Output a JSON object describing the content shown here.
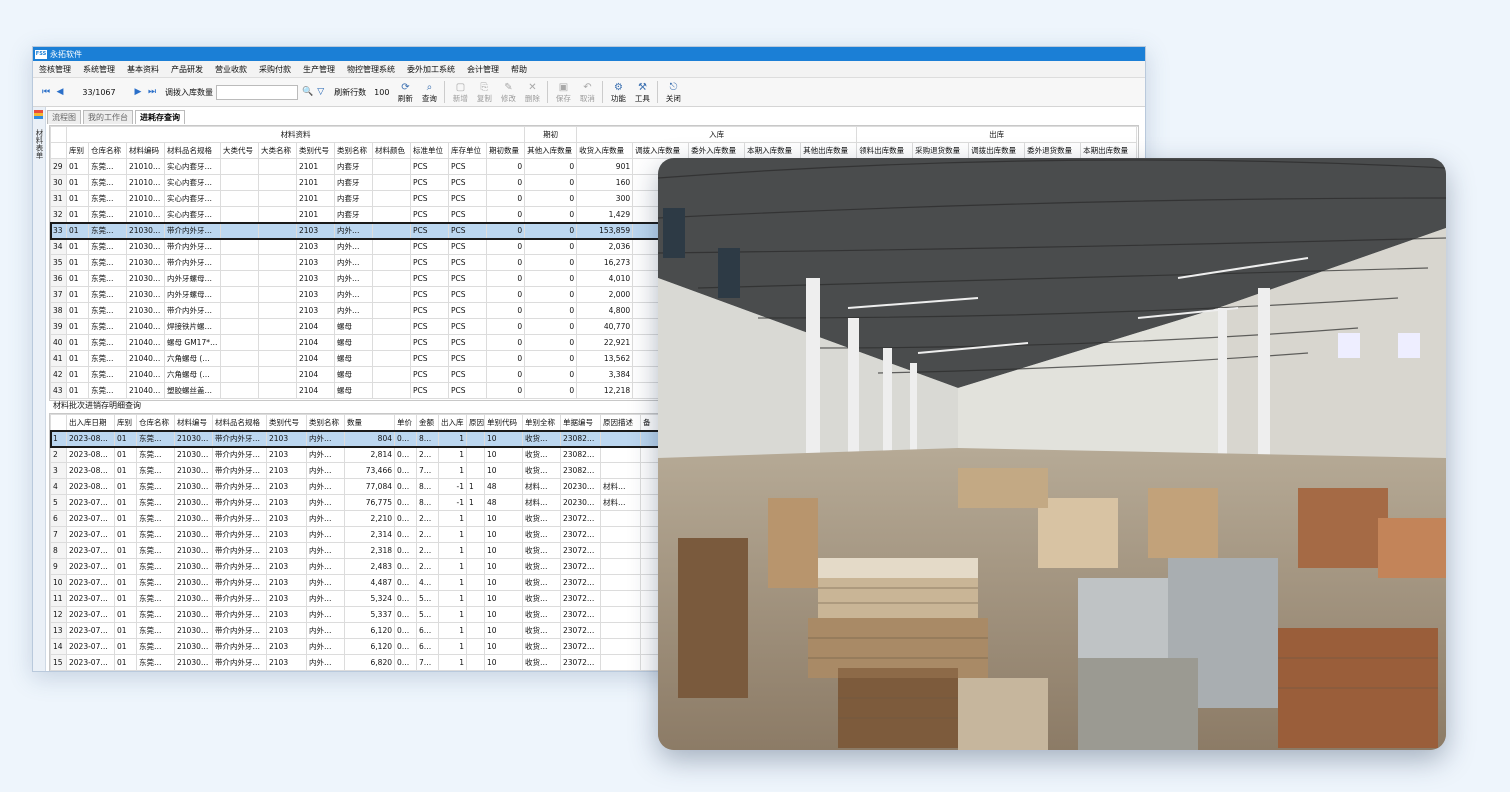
{
  "window": {
    "title": "永拓软件",
    "logo": "FSS"
  },
  "menu": [
    "签核管理",
    "系统管理",
    "基本资料",
    "产品研发",
    "营业收款",
    "采购付款",
    "生产管理",
    "物控管理系统",
    "委外加工系统",
    "会计管理",
    "帮助"
  ],
  "toolbar": {
    "record_pos": "33/1067",
    "query_label": "调拨入库数量",
    "refresh_rows_label": "刷新行数",
    "refresh_rows_value": "100",
    "buttons": [
      {
        "label": "刷新",
        "icon": "refresh-icon",
        "enabled": true
      },
      {
        "label": "查询",
        "icon": "query-icon",
        "enabled": true
      },
      {
        "label": "新增",
        "icon": "new-icon",
        "enabled": false
      },
      {
        "label": "复制",
        "icon": "copy-icon",
        "enabled": false
      },
      {
        "label": "修改",
        "icon": "edit-icon",
        "enabled": false
      },
      {
        "label": "删除",
        "icon": "delete-icon",
        "enabled": false
      },
      {
        "label": "保存",
        "icon": "save-icon",
        "enabled": false
      },
      {
        "label": "取消",
        "icon": "cancel-icon",
        "enabled": false
      },
      {
        "label": "功能",
        "icon": "function-icon",
        "enabled": true
      },
      {
        "label": "工具",
        "icon": "tools-icon",
        "enabled": true
      },
      {
        "label": "关闭",
        "icon": "close-icon",
        "enabled": true
      }
    ]
  },
  "side_panel": {
    "label": "材料表单"
  },
  "tabs": [
    "流程图",
    "我的工作台",
    "进耗存查询"
  ],
  "grid1": {
    "groups": [
      {
        "label": "材料资料",
        "span": 12
      },
      {
        "label": "期初",
        "span": 1
      },
      {
        "label": "入库",
        "span": 5
      },
      {
        "label": "出库",
        "span": 6
      }
    ],
    "headers": [
      "库别",
      "仓库名称",
      "材料编码",
      "材料品名规格",
      "大类代号",
      "大类名称",
      "类别代号",
      "类别名称",
      "材料颜色",
      "标准单位",
      "库存单位",
      "期初数量",
      "其他入库数量",
      "收货入库数量",
      "调拨入库数量",
      "委外入库数量",
      "本期入库数量",
      "其他出库数量",
      "领料出库数量",
      "采购退货数量",
      "调拨出库数量",
      "委外退货数量",
      "本期出库数量"
    ],
    "rows": [
      {
        "no": "29",
        "cells": [
          "01",
          "东莞…",
          "21010…",
          "实心内套牙…",
          "",
          "",
          "2101",
          "内套牙",
          "",
          "PCS",
          "PCS",
          "0",
          "0",
          "901"
        ]
      },
      {
        "no": "30",
        "cells": [
          "01",
          "东莞…",
          "21010…",
          "实心内套牙…",
          "",
          "",
          "2101",
          "内套牙",
          "",
          "PCS",
          "PCS",
          "0",
          "0",
          "160"
        ]
      },
      {
        "no": "31",
        "cells": [
          "01",
          "东莞…",
          "21010…",
          "实心内套牙…",
          "",
          "",
          "2101",
          "内套牙",
          "",
          "PCS",
          "PCS",
          "0",
          "0",
          "300"
        ]
      },
      {
        "no": "32",
        "cells": [
          "01",
          "东莞…",
          "21010…",
          "实心内套牙…",
          "",
          "",
          "2101",
          "内套牙",
          "",
          "PCS",
          "PCS",
          "0",
          "0",
          "1,429"
        ]
      },
      {
        "no": "33",
        "cells": [
          "01",
          "东莞…",
          "21030…",
          "带介内外牙…",
          "",
          "",
          "2103",
          "内外…",
          "",
          "PCS",
          "PCS",
          "0",
          "0",
          "153,859"
        ],
        "selected": true
      },
      {
        "no": "34",
        "cells": [
          "01",
          "东莞…",
          "21030…",
          "带介内外牙…",
          "",
          "",
          "2103",
          "内外…",
          "",
          "PCS",
          "PCS",
          "0",
          "0",
          "2,036"
        ]
      },
      {
        "no": "35",
        "cells": [
          "01",
          "东莞…",
          "21030…",
          "带介内外牙…",
          "",
          "",
          "2103",
          "内外…",
          "",
          "PCS",
          "PCS",
          "0",
          "0",
          "16,273"
        ]
      },
      {
        "no": "36",
        "cells": [
          "01",
          "东莞…",
          "21030…",
          "内外牙螺母…",
          "",
          "",
          "2103",
          "内外…",
          "",
          "PCS",
          "PCS",
          "0",
          "0",
          "4,010"
        ]
      },
      {
        "no": "37",
        "cells": [
          "01",
          "东莞…",
          "21030…",
          "内外牙螺母…",
          "",
          "",
          "2103",
          "内外…",
          "",
          "PCS",
          "PCS",
          "0",
          "0",
          "2,000"
        ]
      },
      {
        "no": "38",
        "cells": [
          "01",
          "东莞…",
          "21030…",
          "带介内外牙…",
          "",
          "",
          "2103",
          "内外…",
          "",
          "PCS",
          "PCS",
          "0",
          "0",
          "4,800"
        ]
      },
      {
        "no": "39",
        "cells": [
          "01",
          "东莞…",
          "21040…",
          "焊接铁片螺…",
          "",
          "",
          "2104",
          "螺母",
          "",
          "PCS",
          "PCS",
          "0",
          "0",
          "40,770"
        ]
      },
      {
        "no": "40",
        "cells": [
          "01",
          "东莞…",
          "21040…",
          "螺母 GM17*…",
          "",
          "",
          "2104",
          "螺母",
          "",
          "PCS",
          "PCS",
          "0",
          "0",
          "22,921"
        ]
      },
      {
        "no": "41",
        "cells": [
          "01",
          "东莞…",
          "21040…",
          "六角螺母 (…",
          "",
          "",
          "2104",
          "螺母",
          "",
          "PCS",
          "PCS",
          "0",
          "0",
          "13,562"
        ]
      },
      {
        "no": "42",
        "cells": [
          "01",
          "东莞…",
          "21040…",
          "六角螺母 (…",
          "",
          "",
          "2104",
          "螺母",
          "",
          "PCS",
          "PCS",
          "0",
          "0",
          "3,384"
        ]
      },
      {
        "no": "43",
        "cells": [
          "01",
          "东莞…",
          "21040…",
          "塑胶螺丝盖…",
          "",
          "",
          "2104",
          "螺母",
          "",
          "PCS",
          "PCS",
          "0",
          "0",
          "12,218"
        ]
      }
    ]
  },
  "section2_title": "材料批次进销存明细查询",
  "grid2": {
    "headers": [
      "出入库日期",
      "库别",
      "仓库名称",
      "材料编号",
      "材料品名规格",
      "类别代号",
      "类别名称",
      "数量",
      "单价",
      "金额",
      "出入库",
      "原因",
      "单别代码",
      "单别全称",
      "单据编号",
      "原因描述",
      "备"
    ],
    "rows": [
      {
        "no": "1",
        "cells": [
          "2023-08…",
          "01",
          "东莞…",
          "21030…",
          "带介内外牙…",
          "2103",
          "内外…",
          "804",
          "0…",
          "8…",
          "1",
          "",
          "10",
          "收货…",
          "23082…",
          "",
          ""
        ],
        "selected": true
      },
      {
        "no": "2",
        "cells": [
          "2023-08…",
          "01",
          "东莞…",
          "21030…",
          "带介内外牙…",
          "2103",
          "内外…",
          "2,814",
          "0…",
          "2…",
          "1",
          "",
          "10",
          "收货…",
          "23082…",
          "",
          ""
        ]
      },
      {
        "no": "3",
        "cells": [
          "2023-08…",
          "01",
          "东莞…",
          "21030…",
          "带介内外牙…",
          "2103",
          "内外…",
          "73,466",
          "0…",
          "7…",
          "1",
          "",
          "10",
          "收货…",
          "23082…",
          "",
          ""
        ]
      },
      {
        "no": "4",
        "cells": [
          "2023-08…",
          "01",
          "东莞…",
          "21030…",
          "带介内外牙…",
          "2103",
          "内外…",
          "77,084",
          "0…",
          "8…",
          "-1",
          "1",
          "48",
          "材料…",
          "20230…",
          "材料…",
          ""
        ]
      },
      {
        "no": "5",
        "cells": [
          "2023-07…",
          "01",
          "东莞…",
          "21030…",
          "带介内外牙…",
          "2103",
          "内外…",
          "76,775",
          "0…",
          "8…",
          "-1",
          "1",
          "48",
          "材料…",
          "20230…",
          "材料…",
          ""
        ]
      },
      {
        "no": "6",
        "cells": [
          "2023-07…",
          "01",
          "东莞…",
          "21030…",
          "带介内外牙…",
          "2103",
          "内外…",
          "2,210",
          "0…",
          "2…",
          "1",
          "",
          "10",
          "收货…",
          "23072…",
          "",
          ""
        ]
      },
      {
        "no": "7",
        "cells": [
          "2023-07…",
          "01",
          "东莞…",
          "21030…",
          "带介内外牙…",
          "2103",
          "内外…",
          "2,314",
          "0…",
          "2…",
          "1",
          "",
          "10",
          "收货…",
          "23072…",
          "",
          ""
        ]
      },
      {
        "no": "8",
        "cells": [
          "2023-07…",
          "01",
          "东莞…",
          "21030…",
          "带介内外牙…",
          "2103",
          "内外…",
          "2,318",
          "0…",
          "2…",
          "1",
          "",
          "10",
          "收货…",
          "23072…",
          "",
          ""
        ]
      },
      {
        "no": "9",
        "cells": [
          "2023-07…",
          "01",
          "东莞…",
          "21030…",
          "带介内外牙…",
          "2103",
          "内外…",
          "2,483",
          "0…",
          "2…",
          "1",
          "",
          "10",
          "收货…",
          "23072…",
          "",
          ""
        ]
      },
      {
        "no": "10",
        "cells": [
          "2023-07…",
          "01",
          "东莞…",
          "21030…",
          "带介内外牙…",
          "2103",
          "内外…",
          "4,487",
          "0…",
          "4…",
          "1",
          "",
          "10",
          "收货…",
          "23072…",
          "",
          ""
        ]
      },
      {
        "no": "11",
        "cells": [
          "2023-07…",
          "01",
          "东莞…",
          "21030…",
          "带介内外牙…",
          "2103",
          "内外…",
          "5,324",
          "0…",
          "5…",
          "1",
          "",
          "10",
          "收货…",
          "23072…",
          "",
          ""
        ]
      },
      {
        "no": "12",
        "cells": [
          "2023-07…",
          "01",
          "东莞…",
          "21030…",
          "带介内外牙…",
          "2103",
          "内外…",
          "5,337",
          "0…",
          "5…",
          "1",
          "",
          "10",
          "收货…",
          "23072…",
          "",
          ""
        ]
      },
      {
        "no": "13",
        "cells": [
          "2023-07…",
          "01",
          "东莞…",
          "21030…",
          "带介内外牙…",
          "2103",
          "内外…",
          "6,120",
          "0…",
          "6…",
          "1",
          "",
          "10",
          "收货…",
          "23072…",
          "",
          ""
        ]
      },
      {
        "no": "14",
        "cells": [
          "2023-07…",
          "01",
          "东莞…",
          "21030…",
          "带介内外牙…",
          "2103",
          "内外…",
          "6,120",
          "0…",
          "6…",
          "1",
          "",
          "10",
          "收货…",
          "23072…",
          "",
          ""
        ]
      },
      {
        "no": "15",
        "cells": [
          "2023-07…",
          "01",
          "东莞…",
          "21030…",
          "带介内外牙…",
          "2103",
          "内外…",
          "6,820",
          "0…",
          "7…",
          "1",
          "",
          "10",
          "收货…",
          "23072…",
          "",
          ""
        ]
      }
    ]
  },
  "colors": {
    "title_bar": "#1b7fd6",
    "selected_row": "#bcd7f0",
    "background": "#eef5fc"
  }
}
